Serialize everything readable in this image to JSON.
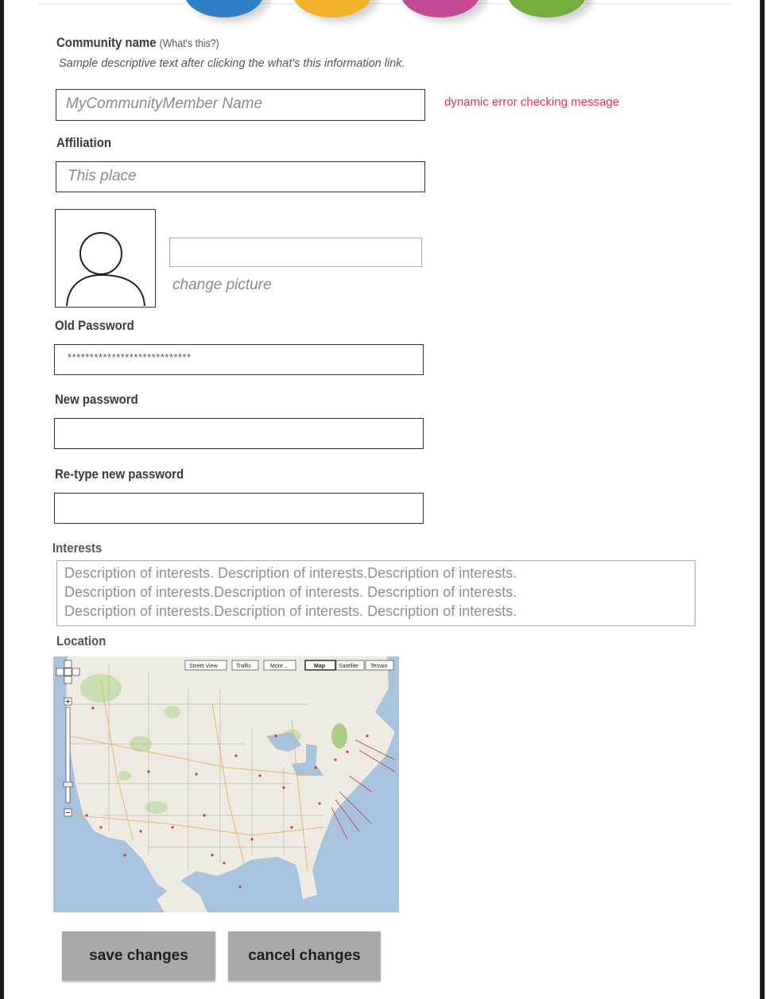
{
  "header": {
    "nav_dot_colors": [
      "#2f7fc4",
      "#f2b32a",
      "#c24b93",
      "#73ad3b"
    ]
  },
  "community_name": {
    "label": "Community name",
    "help_link": "(What's this?)",
    "helper_text": "Sample descriptive text after clicking the what's this information link.",
    "placeholder": "MyCommunityMember Name",
    "error_message": "dynamic error checking message"
  },
  "affiliation": {
    "label": "Affiliation",
    "placeholder": "This place"
  },
  "picture": {
    "change_label": "change picture"
  },
  "old_password": {
    "label": "Old Password",
    "value": "****************************"
  },
  "new_password": {
    "label": "New password"
  },
  "retype_password": {
    "label": "Re-type new password"
  },
  "interests": {
    "label": "Interests",
    "lines": [
      "Description of interests. Description of interests.Description of interests.",
      "Description of interests.Description of interests. Description of interests.",
      "Description of interests.Description of interests. Description of interests."
    ]
  },
  "location": {
    "label": "Location",
    "map_tabs": [
      "Street View",
      "Traffic",
      "More...",
      "Map",
      "Satellite",
      "Terrain"
    ],
    "selected_tab": "Map"
  },
  "actions": {
    "save_label": "save changes",
    "cancel_label": "cancel changes"
  },
  "colors": {
    "error": "#e8344a",
    "button": "#a9a9a9"
  }
}
